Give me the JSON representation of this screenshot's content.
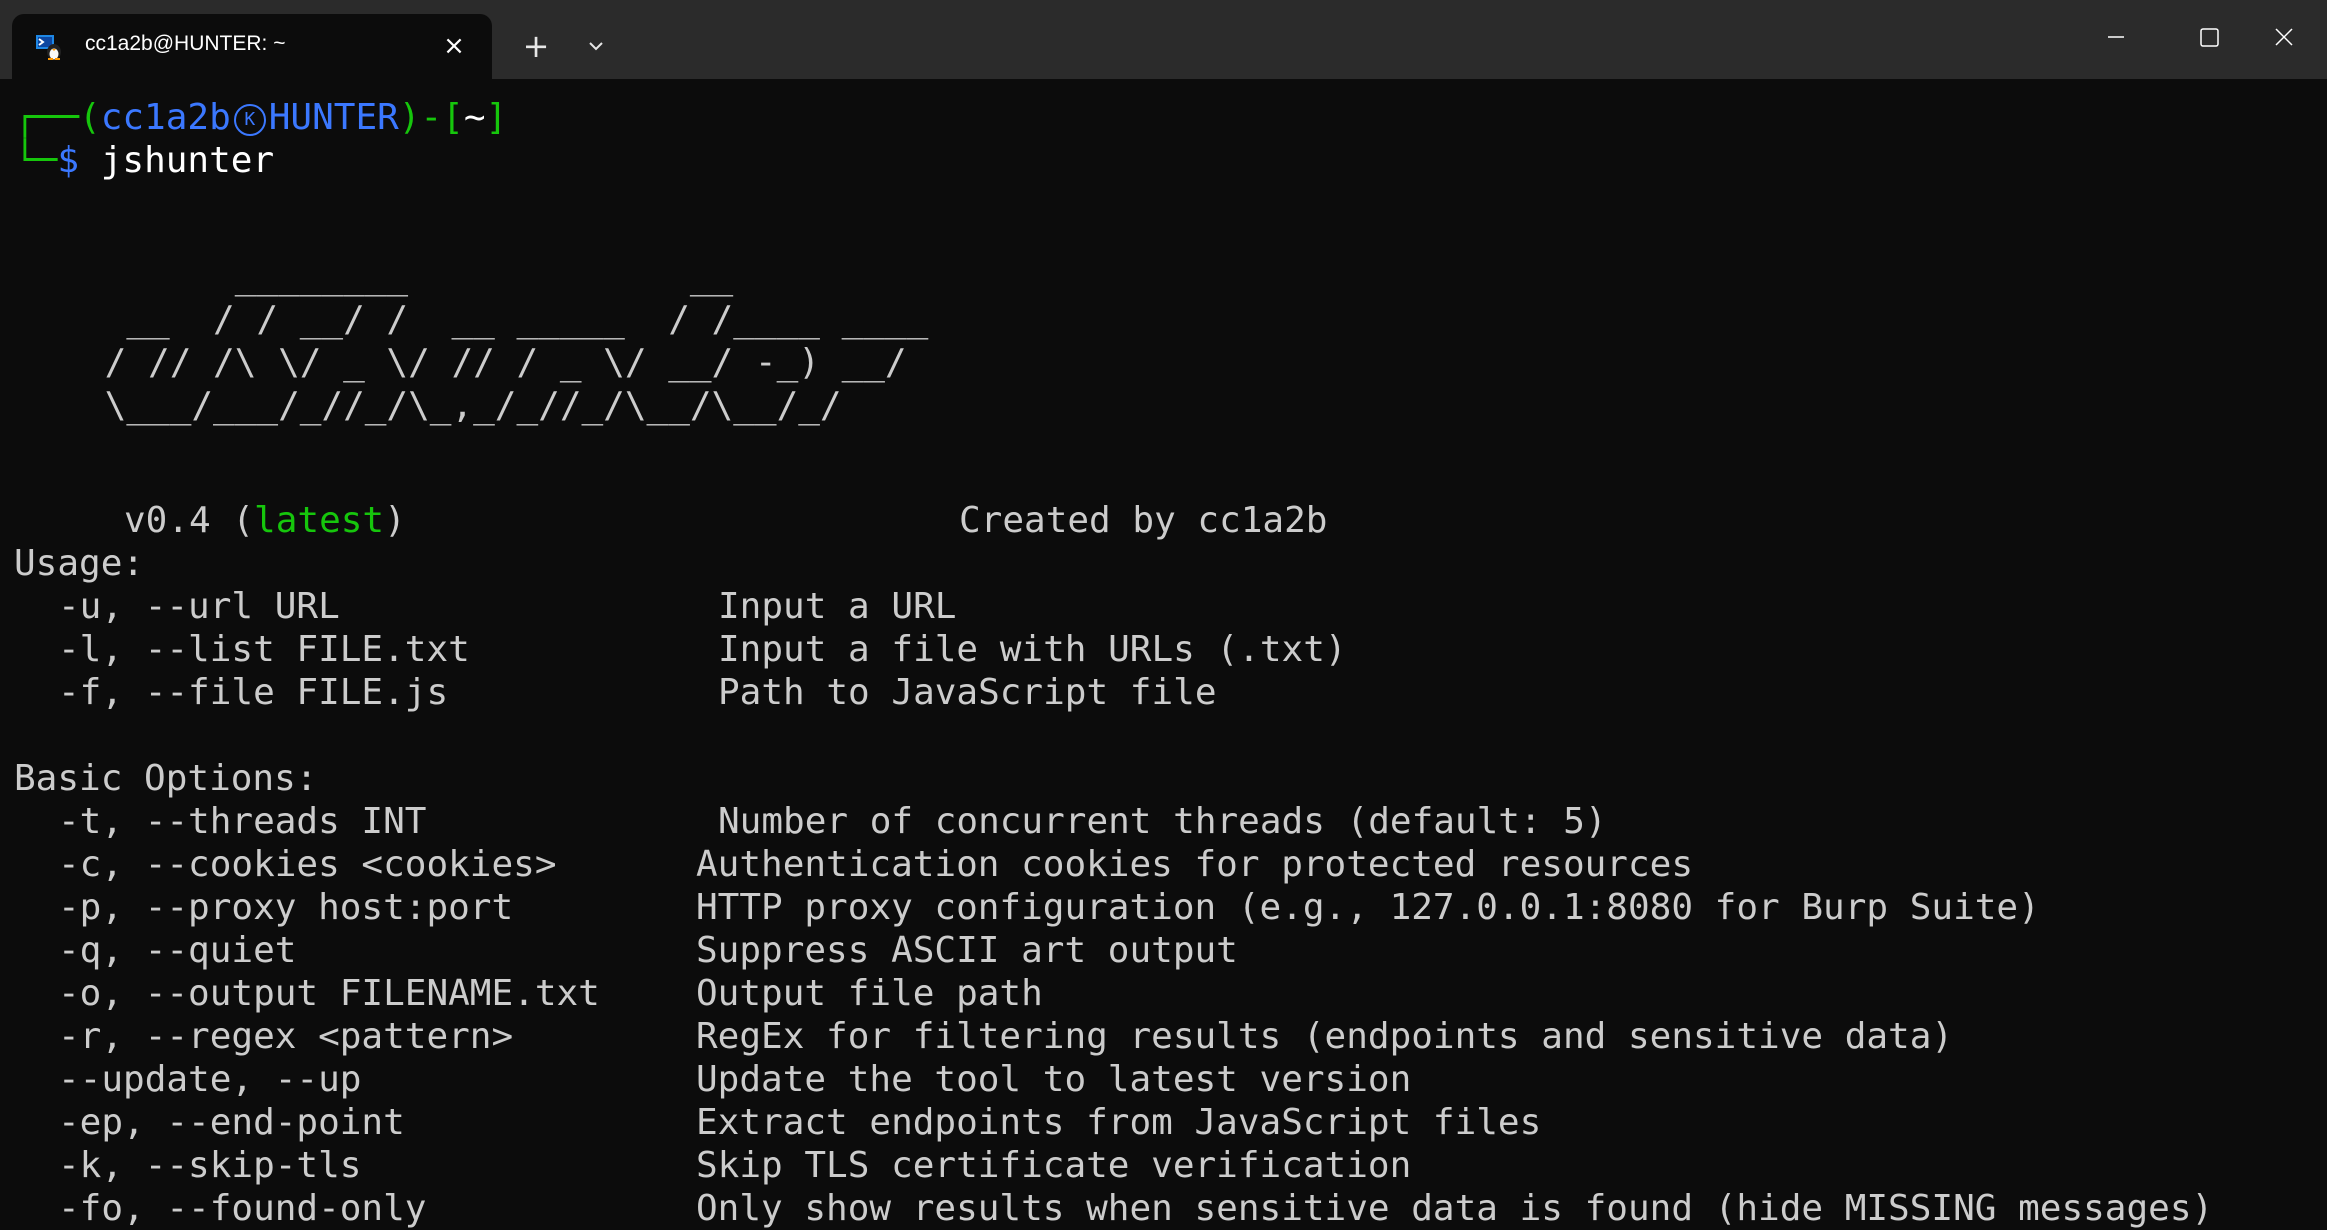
{
  "window": {
    "tab_title": "cc1a2b@HUNTER: ~",
    "tab_icon": "terminal-penguin-icon",
    "close_tab_glyph": "×",
    "new_tab_glyph": "+",
    "dropdown_icon": "chevron-down-icon"
  },
  "prompt": {
    "corner_top": "┌──(",
    "user": "cc1a2b",
    "separator_glyph": "K",
    "host": "HUNTER",
    "close_paren": ")-[",
    "cwd": "~",
    "close_bracket": "]",
    "corner_bottom": "└─",
    "dollar": "$",
    "command": "jshunter"
  },
  "banner": {
    "ascii_art": [
      "       ________             __",
      "  __  / / __/ /  __ _____  / /____ ____",
      " / // /\\ \\/ _ \\/ // / _ \\/ __/ -_) __/",
      " \\___/___/_//_/\\_,_/_//_/\\__/\\__/_/"
    ],
    "version": "v0.4 (",
    "version_tag": "latest",
    "version_close": ")",
    "credit": "Created by cc1a2b"
  },
  "usage": {
    "header": "Usage:",
    "options": [
      {
        "flag": "-u, --url URL",
        "desc": "Input a URL"
      },
      {
        "flag": "-l, --list FILE.txt",
        "desc": "Input a file with URLs (.txt)"
      },
      {
        "flag": "-f, --file FILE.js",
        "desc": "Path to JavaScript file"
      }
    ]
  },
  "basic_options": {
    "header": "Basic Options:",
    "options": [
      {
        "flag": "-t, --threads INT",
        "desc": "Number of concurrent threads (default: 5)"
      },
      {
        "flag": "-c, --cookies <cookies>",
        "desc": "Authentication cookies for protected resources"
      },
      {
        "flag": "-p, --proxy host:port",
        "desc": "HTTP proxy configuration (e.g., 127.0.0.1:8080 for Burp Suite)"
      },
      {
        "flag": "-q, --quiet",
        "desc": "Suppress ASCII art output"
      },
      {
        "flag": "-o, --output FILENAME.txt",
        "desc": "Output file path"
      },
      {
        "flag": "-r, --regex <pattern>",
        "desc": "RegEx for filtering results (endpoints and sensitive data)"
      },
      {
        "flag": "--update, --up",
        "desc": "Update the tool to latest version"
      },
      {
        "flag": "-ep, --end-point",
        "desc": "Extract endpoints from JavaScript files"
      },
      {
        "flag": "-k, --skip-tls",
        "desc": "Skip TLS certificate verification"
      },
      {
        "flag": "-fo, --found-only",
        "desc": "Only show results when sensitive data is found (hide MISSING messages)"
      }
    ]
  },
  "colors": {
    "background": "#0c0c0c",
    "titlebar": "#2b2b2b",
    "text": "#cccccc",
    "blue": "#3b78ff",
    "green": "#16c60c"
  }
}
